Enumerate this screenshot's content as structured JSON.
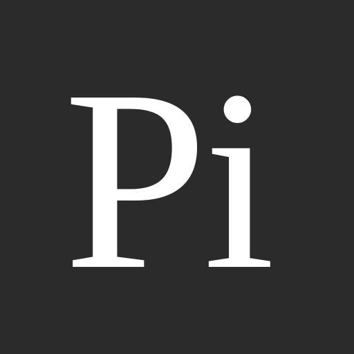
{
  "logo": {
    "text": "Pi"
  },
  "colors": {
    "background": "#2b2b2b",
    "foreground": "#ffffff"
  }
}
